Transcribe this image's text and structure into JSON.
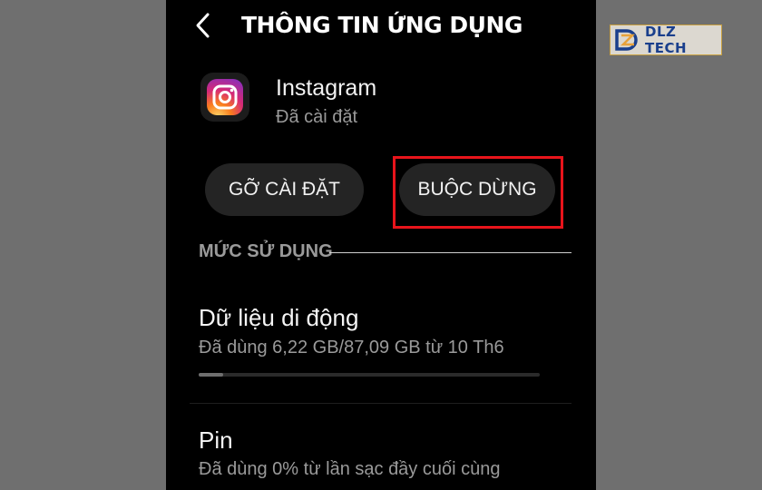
{
  "header": {
    "title": "THÔNG TIN ỨNG DỤNG",
    "back_icon": "chevron-left-icon"
  },
  "app": {
    "name": "Instagram",
    "status": "Đã cài đặt",
    "icon": "instagram-icon"
  },
  "actions": {
    "uninstall_label": "GỠ CÀI ĐẶT",
    "force_stop_label": "BUỘC DỪNG"
  },
  "usage": {
    "section_title": "MỨC SỬ DỤNG",
    "mobile_data": {
      "title": "Dữ liệu di động",
      "subtitle": "Đã dùng 6,22 GB/87,09 GB từ 10 Th6",
      "progress_fraction": 0.0714
    },
    "battery": {
      "title": "Pin",
      "subtitle": "Đã dùng 0% từ lần sạc đầy cuối cùng"
    }
  },
  "watermark": {
    "text": "DLZ TECH"
  },
  "colors": {
    "background": "#6f6f6f",
    "phone_bg": "#000000",
    "button_bg": "#242424",
    "highlight": "#e8141b",
    "secondary_text": "#9a9a9a"
  }
}
